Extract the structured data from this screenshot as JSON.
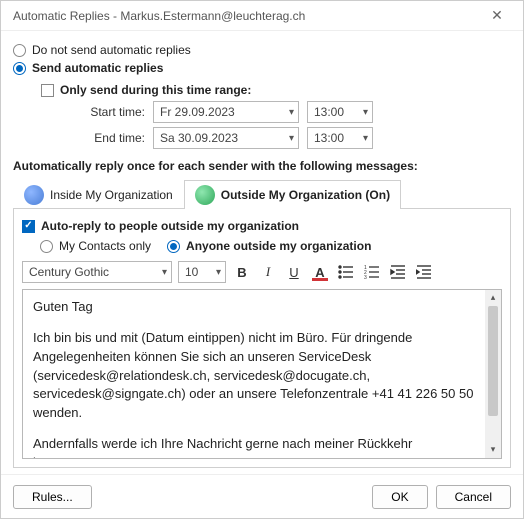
{
  "window": {
    "title": "Automatic Replies - Markus.Estermann@leuchterag.ch"
  },
  "options": {
    "dont_send_label": "Do not send automatic replies",
    "send_label": "Send automatic replies",
    "only_range_label": "Only send during this time range:",
    "start_label": "Start time:",
    "end_label": "End time:",
    "start_date": "Fr 29.09.2023",
    "start_time": "13:00",
    "end_date": "Sa 30.09.2023",
    "end_time": "13:00"
  },
  "section": {
    "reply_once_label": "Automatically reply once for each sender with the following messages:"
  },
  "tabs": {
    "inside_label": "Inside My Organization",
    "outside_label": "Outside My Organization (On)"
  },
  "outside": {
    "autoreply_label": "Auto-reply to people outside my organization",
    "contacts_only_label": "My Contacts only",
    "anyone_label": "Anyone outside my organization"
  },
  "toolbar": {
    "font": "Century Gothic",
    "size": "10"
  },
  "message": {
    "greeting": "Guten Tag",
    "body1": "Ich bin bis und mit (Datum eintippen) nicht im Büro. Für dringende Angelegenheiten können Sie sich an unseren ServiceDesk (servicedesk@relationdesk.ch, servicedesk@docugate.ch, servicedesk@signgate.ch) oder an unsere Telefonzentrale +41 41 226 50 50 wenden.",
    "body2": "Andernfalls werde ich Ihre Nachricht gerne nach meiner Rückkehr beantworten."
  },
  "footer": {
    "rules": "Rules...",
    "ok": "OK",
    "cancel": "Cancel"
  }
}
